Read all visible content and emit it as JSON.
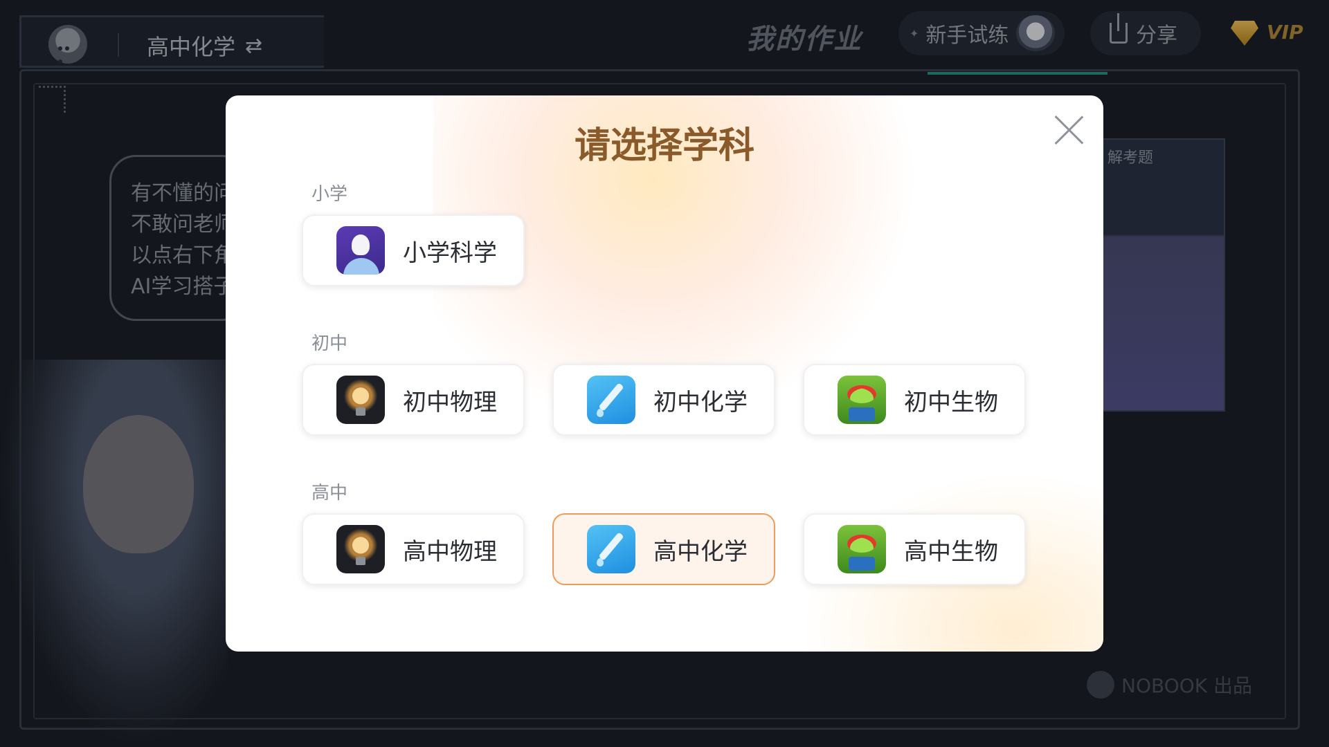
{
  "header": {
    "current_subject": "高中化学",
    "homework_title": "我的作业",
    "trial_label": "新手试练",
    "share_label": "分享",
    "vip_label": "VIP"
  },
  "background": {
    "bubble_lines": [
      "有不懂的问",
      "不敢问老师",
      "以点右下角",
      "AI学习搭子"
    ],
    "right_card_label": "解考题",
    "brand_footer": "NOBOOK 出品"
  },
  "modal": {
    "title": "请选择学科",
    "sections": [
      {
        "label": "小学",
        "subjects": [
          {
            "name": "小学科学",
            "icon": "astronaut-icon"
          }
        ]
      },
      {
        "label": "初中",
        "subjects": [
          {
            "name": "初中物理",
            "icon": "lightbulb-icon"
          },
          {
            "name": "初中化学",
            "icon": "dropper-icon"
          },
          {
            "name": "初中生物",
            "icon": "frog-icon"
          }
        ]
      },
      {
        "label": "高中",
        "subjects": [
          {
            "name": "高中物理",
            "icon": "lightbulb-icon"
          },
          {
            "name": "高中化学",
            "icon": "dropper-icon",
            "selected": true
          },
          {
            "name": "高中生物",
            "icon": "frog-icon"
          }
        ]
      }
    ]
  },
  "colors": {
    "accent": "#f19a57",
    "title": "#8a5a2a",
    "background": "#1b1f27"
  }
}
